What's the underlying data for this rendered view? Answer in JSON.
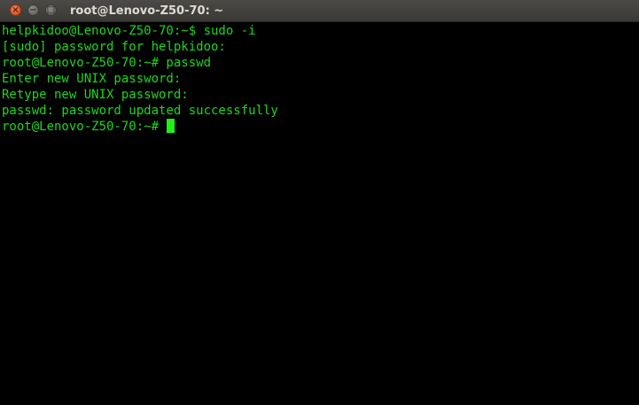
{
  "window": {
    "title": "root@Lenovo-Z50-70: ~",
    "buttons": {
      "close_glyph": "×",
      "minimize_glyph": "−",
      "maximize_glyph": "□"
    }
  },
  "terminal": {
    "lines": [
      "helpkidoo@Lenovo-Z50-70:~$ sudo -i",
      "[sudo] password for helpkidoo:",
      "root@Lenovo-Z50-70:~# passwd",
      "Enter new UNIX password:",
      "Retype new UNIX password:",
      "passwd: password updated successfully"
    ],
    "current_prompt": "root@Lenovo-Z50-70:~# "
  },
  "colors": {
    "terminal_text": "#1dd71b",
    "terminal_background": "#000000",
    "cursor": "#1ef01a",
    "titlebar": "#3f3e3a"
  }
}
